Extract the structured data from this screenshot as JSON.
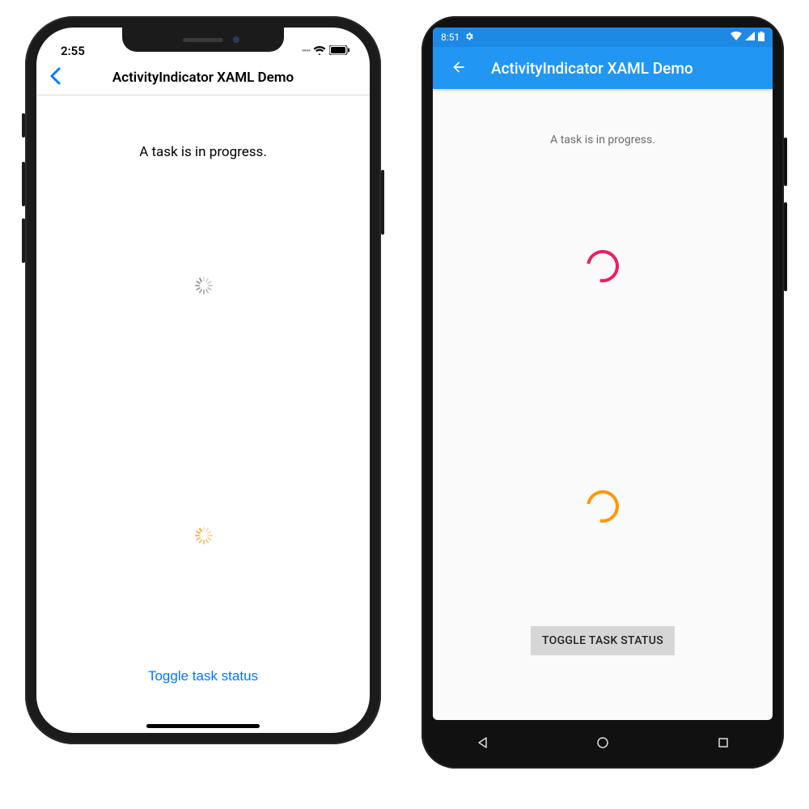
{
  "ios": {
    "status": {
      "time": "2:55"
    },
    "nav": {
      "title": "ActivityIndicator XAML Demo"
    },
    "content": {
      "task_label": "A task is in progress.",
      "spinner1_color": "#8e8e93",
      "spinner2_color": "#ffad33",
      "toggle_label": "Toggle task status"
    }
  },
  "android": {
    "status": {
      "time": "8:51"
    },
    "appbar": {
      "title": "ActivityIndicator XAML Demo"
    },
    "content": {
      "task_label": "A task is in progress.",
      "spinner1_color": "#e91e63",
      "spinner2_color": "#ff9800",
      "toggle_label": "TOGGLE TASK STATUS"
    }
  }
}
